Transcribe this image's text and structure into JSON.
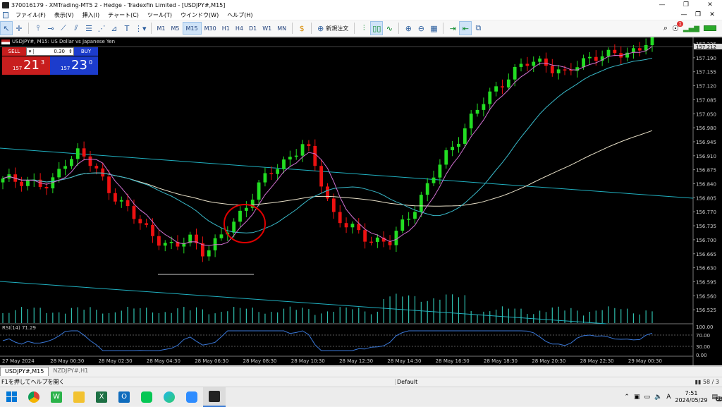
{
  "window": {
    "title": "370016179 - XMTrading-MT5 2 - Hedge - Tradexfin Limited - [USDJPY#,M15]",
    "controls": [
      "—",
      "❐",
      "✕"
    ]
  },
  "menu": [
    "ファイル(F)",
    "表示(V)",
    "挿入(I)",
    "チャート(C)",
    "ツール(T)",
    "ウインドウ(W)",
    "ヘルプ(H)"
  ],
  "toolbar": {
    "timeframes": [
      "M1",
      "M5",
      "M15",
      "M30",
      "H1",
      "H4",
      "D1",
      "W1",
      "MN"
    ],
    "selected_timeframe": "M15",
    "new_order_label": "新規注文",
    "notification_count": "1"
  },
  "chart": {
    "header": "USDJPY#, M15:  US Dollar vs Japanese Yen",
    "current_price_label": "157.212",
    "price_labels": [
      "157.225",
      "157.190",
      "157.155",
      "157.120",
      "157.085",
      "157.050",
      "156.980",
      "156.945",
      "156.910",
      "156.875",
      "156.840",
      "156.805",
      "156.770",
      "156.735",
      "156.700",
      "156.665",
      "156.630",
      "156.595",
      "156.560",
      "156.525"
    ],
    "time_labels": [
      "27 May 2024",
      "28 May 00:30",
      "28 May 02:30",
      "28 May 04:30",
      "28 May 06:30",
      "28 May 08:30",
      "28 May 10:30",
      "28 May 12:30",
      "28 May 14:30",
      "28 May 16:30",
      "28 May 18:30",
      "28 May 20:30",
      "28 May 22:30",
      "29 May 00:30"
    ],
    "rsi_label": "RSI(14) 71.29",
    "rsi_levels": [
      "100.00",
      "70.00",
      "30.00",
      "0.00"
    ],
    "colors": {
      "bull": "#22dd22",
      "bear": "#ee1111",
      "ma_fast": "#d070d0",
      "ma_mid": "#38b8c8",
      "ma_slow": "#e8e0c8",
      "trend": "#20b0c0",
      "annotation": "#e00000",
      "rsi": "#3a78d8"
    }
  },
  "one_click": {
    "sell_label": "SELL",
    "buy_label": "BUY",
    "volume": "0.30",
    "sell_prefix": "157",
    "sell_big": "21",
    "sell_sup": "3",
    "buy_prefix": "157",
    "buy_big": "23",
    "buy_sup": "0"
  },
  "tabs": [
    "USDJPY#,M15",
    "NZDJPY#,H1"
  ],
  "status": {
    "help": "F1を押してヘルプを開く",
    "profile": "Default",
    "traffic": "58 / 3"
  },
  "taskbar": {
    "time": "7:51",
    "date": "2024/05/29",
    "tray_ime": "A",
    "notifications": "21"
  }
}
